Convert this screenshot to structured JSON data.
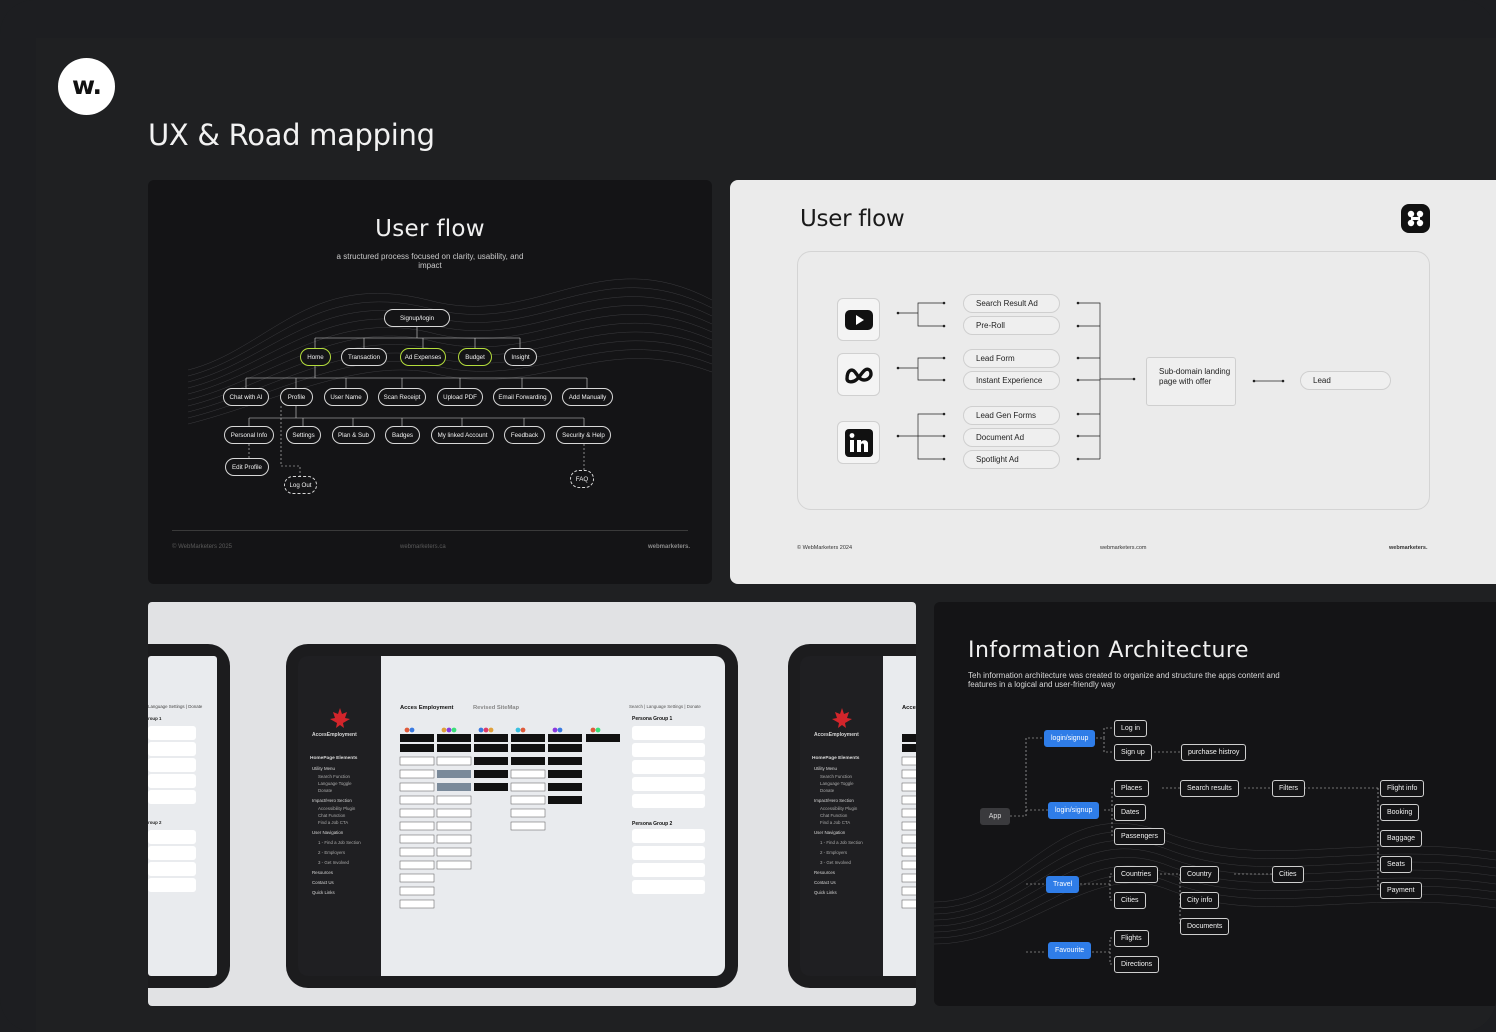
{
  "brand": {
    "logo_text": "w."
  },
  "page_title": "UX & Road mapping",
  "user_flow_dark": {
    "title": "User flow",
    "subtitle": "a structured process focused on clarity, usability, and impact",
    "root": "Signup/login",
    "level1": [
      "Home",
      "Transaction",
      "Ad Expenses",
      "Budget",
      "Insight"
    ],
    "level2": [
      "Chat with AI",
      "Profile",
      "User Name",
      "Scan Receipt",
      "Upload PDF",
      "Email Forwarding",
      "Add Manually"
    ],
    "level3": [
      "Personal Info",
      "Settings",
      "Plan & Sub",
      "Badges",
      "My linked Account",
      "Feedback",
      "Security & Help"
    ],
    "level4": [
      "Edit Profile",
      "Log Out",
      "FAQ"
    ],
    "footer": {
      "left": "© WebMarketers 2025",
      "center": "webmarketers.ca",
      "right": "webmarketers."
    }
  },
  "user_flow_light": {
    "title": "User flow",
    "channels": [
      "youtube-icon",
      "meta-icon",
      "linkedin-icon"
    ],
    "ads": [
      "Search Result Ad",
      "Pre-Roll",
      "Lead Form",
      "Instant Experience",
      "Lead Gen Forms",
      "Document Ad",
      "Spotlight Ad"
    ],
    "landing": "Sub-domain landing page with offer",
    "lead": "Lead",
    "footer": {
      "left": "© WebMarketers 2024",
      "center": "webmarketers.com",
      "right": "webmarketers."
    }
  },
  "sitemap": {
    "brand": "AccesEmployment",
    "title": "Acces Employment",
    "subtitle": "Revised SiteMap",
    "topnav": "Search  |  Language Settings  |  Donate",
    "sidebar_heading": "HomePage Elements",
    "sidebar_items": [
      "Utility Menu",
      "Search Function",
      "Language Toggle",
      "Donate",
      "Impact/Hero Section",
      "Accessibility Plugin",
      "Chat Function",
      "Find a Job CTA",
      "User Navigation",
      "1 - Find a Job Section",
      "2 - Employers",
      "3 - Get Involved",
      "Resources",
      "Contact Us",
      "Quick Links"
    ],
    "persona_groups": [
      "Persona Group 1",
      "Persona Group 2"
    ],
    "left_partial": {
      "nav": "Language Settings  |  Donate",
      "groups": [
        "roup 1",
        "roup 2"
      ]
    }
  },
  "information_architecture": {
    "title": "Information Architecture",
    "description": "Teh information architecture was created to organize and structure the apps content and features in a logical and user-friendly way",
    "root": "App",
    "primary": [
      "login/signup",
      "login/signup",
      "Travel",
      "Favourite"
    ],
    "auth": [
      "Log in",
      "Sign up",
      "purchase histroy"
    ],
    "places": [
      "Places",
      "Dates",
      "Passengers",
      "Search results",
      "Filters"
    ],
    "flight": [
      "Flight info",
      "Booking",
      "Baggage",
      "Seats",
      "Payment"
    ],
    "travel": [
      "Countries",
      "Cities",
      "Country",
      "City info",
      "Documents",
      "Cities"
    ],
    "favourite": [
      "Flights",
      "Directions"
    ]
  }
}
